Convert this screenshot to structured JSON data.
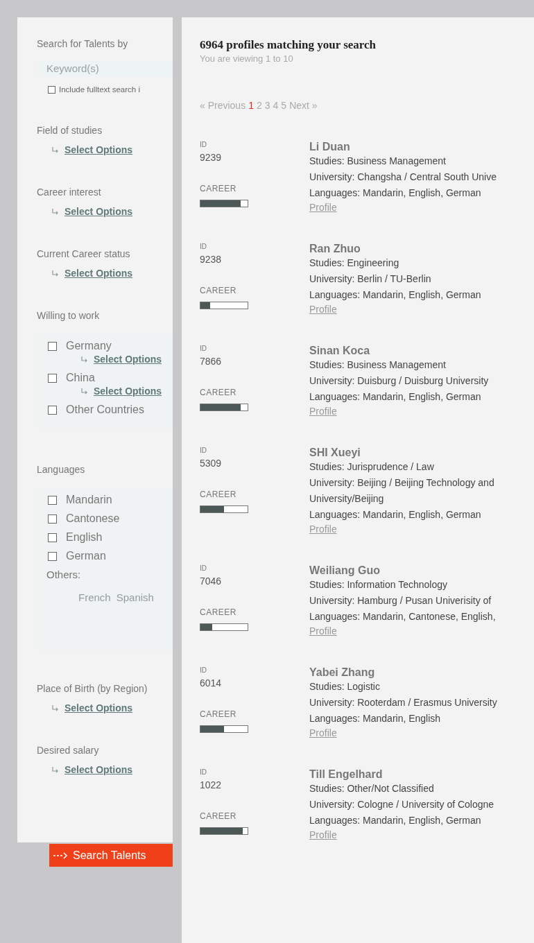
{
  "sidebar": {
    "search": {
      "label": "Search for Talents by",
      "placeholder": "Keyword(s)",
      "fulltext": {
        "label": "Include fulltext search i",
        "checked": false
      }
    },
    "filters": [
      {
        "kind": "select",
        "label": "Field of studies",
        "link": "Select Options"
      },
      {
        "kind": "select",
        "label": "Career interest",
        "link": "Select Options"
      },
      {
        "kind": "select",
        "label": "Current Career status",
        "link": "Select Options"
      },
      {
        "kind": "checklist",
        "label": "Willing to work",
        "options": [
          {
            "label": "Germany",
            "checked": false,
            "link": "Select Options"
          },
          {
            "label": "China",
            "checked": false,
            "link": "Select Options"
          },
          {
            "label": "Other Countries",
            "checked": false
          }
        ]
      },
      {
        "kind": "languages",
        "label": "Languages",
        "options": [
          {
            "label": "Mandarin",
            "checked": false
          },
          {
            "label": "Cantonese",
            "checked": false
          },
          {
            "label": "English",
            "checked": false
          },
          {
            "label": "German",
            "checked": false
          }
        ],
        "others_label": "Others:",
        "others": [
          "French",
          "Spanish"
        ]
      },
      {
        "kind": "select",
        "label": "Place of Birth (by Region)",
        "link": "Select Options"
      },
      {
        "kind": "select",
        "label": "Desired salary",
        "link": "Select Options"
      }
    ],
    "button": "Search Talents"
  },
  "results": {
    "title": "6964 profiles matching your search",
    "subtitle": "You are viewing 1 to 10",
    "pagination": {
      "previous": "« Previous",
      "pages": [
        {
          "label": "1",
          "selected": true
        },
        {
          "label": "2",
          "selected": false
        },
        {
          "label": "3",
          "selected": false
        },
        {
          "label": "4",
          "selected": false
        },
        {
          "label": "5",
          "selected": false
        }
      ],
      "next": "Next »"
    },
    "profiles": [
      {
        "id_label": "ID",
        "id": "9239",
        "career_label": "CAREER",
        "level": 0.85,
        "name": "Li Duan",
        "lines": [
          "Studies: Business Management",
          "University: Changsha / Central South Unive",
          "Languages: Mandarin, English, German"
        ],
        "link": "Profile"
      },
      {
        "id_label": "ID",
        "id": "9238",
        "career_label": "CAREER",
        "level": 0.2,
        "name": "Ran Zhuo",
        "lines": [
          "Studies: Engineering",
          "University: Berlin / TU-Berlin",
          "Languages: Mandarin, English, German"
        ],
        "link": "Profile"
      },
      {
        "id_label": "ID",
        "id": "7866",
        "career_label": "CAREER",
        "level": 0.85,
        "name": "Sinan Koca",
        "lines": [
          "Studies: Business Management",
          "University: Duisburg / Duisburg University",
          "Languages: Mandarin, English, German"
        ],
        "link": "Profile"
      },
      {
        "id_label": "ID",
        "id": "5309",
        "career_label": "CAREER",
        "level": 0.5,
        "name": "SHI Xueyi",
        "lines": [
          "Studies: Jurisprudence / Law",
          "University: Beijing / Beijing Technology and",
          "University/Beijing",
          "Languages: Mandarin, English, German"
        ],
        "link": "Profile"
      },
      {
        "id_label": "ID",
        "id": "7046",
        "career_label": "CAREER",
        "level": 0.25,
        "name": "Weiliang Guo",
        "lines": [
          "Studies: Information Technology",
          "University: Hamburg / Pusan Univerisity of",
          "Languages: Mandarin, Cantonese, English,"
        ],
        "link": "Profile"
      },
      {
        "id_label": "ID",
        "id": "6014",
        "career_label": "CAREER",
        "level": 0.5,
        "name": "Yabei Zhang",
        "lines": [
          "Studies: Logistic",
          "University: Rooterdam / Erasmus University",
          "Languages: Mandarin, English"
        ],
        "link": "Profile"
      },
      {
        "id_label": "ID",
        "id": "1022",
        "career_label": "CAREER",
        "level": 0.9,
        "name": "Till Engelhard",
        "lines": [
          "Studies: Other/Not Classified",
          "University: Cologne / University of Cologne",
          "Languages: Mandarin, English, German"
        ],
        "link": "Profile"
      }
    ]
  }
}
